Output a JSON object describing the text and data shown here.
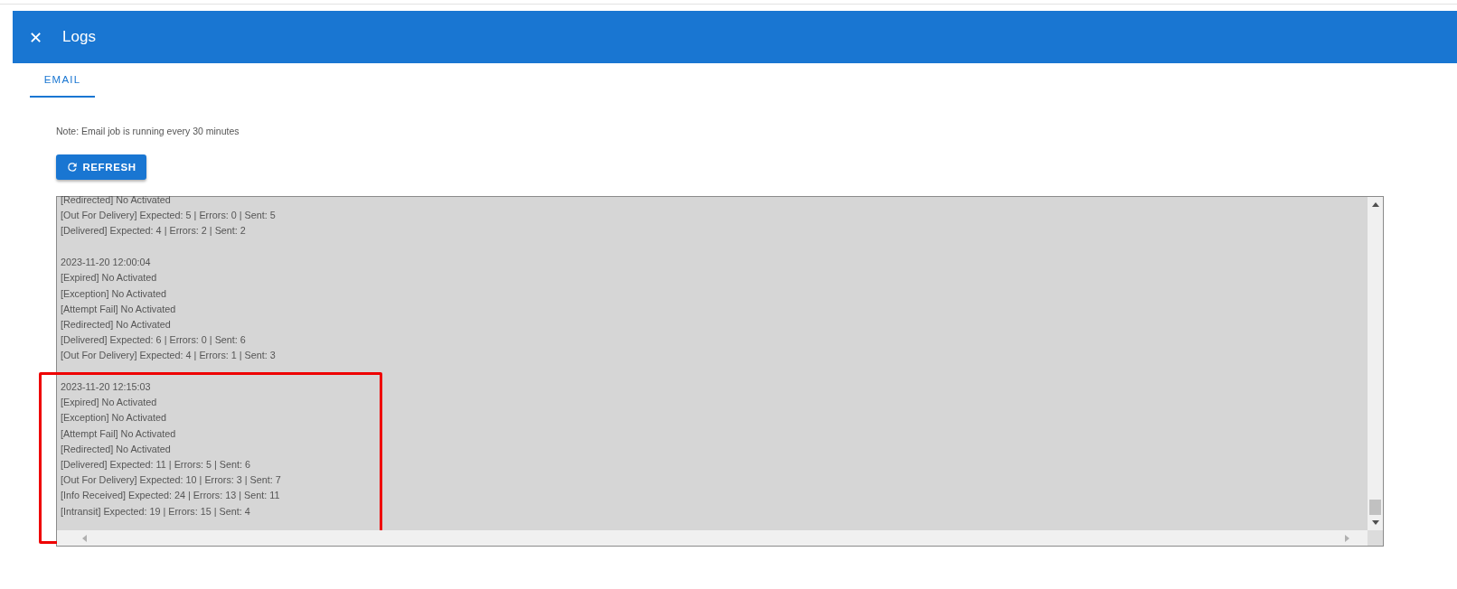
{
  "window": {
    "title": "Logs",
    "close": "✕"
  },
  "tabs": [
    {
      "label": "EMAIL",
      "selected": true
    }
  ],
  "note": "Note: Email job is running every 30 minutes",
  "refresh_button": {
    "label": "REFRESH"
  },
  "log_entries": [
    {
      "highlighted": false,
      "lines": [
        "[Redirected] No Activated",
        "[Out For Delivery] Expected: 5 | Errors: 0 | Sent: 5",
        "[Delivered] Expected: 4 | Errors: 2 | Sent: 2"
      ]
    },
    {
      "highlighted": false,
      "lines": [
        "2023-11-20 12:00:04",
        "[Expired] No Activated",
        "[Exception] No Activated",
        "[Attempt Fail] No Activated",
        "[Redirected] No Activated",
        "[Delivered] Expected: 6 | Errors: 0 | Sent: 6",
        "[Out For Delivery] Expected: 4 | Errors: 1 | Sent: 3"
      ]
    },
    {
      "highlighted": true,
      "lines": [
        "2023-11-20 12:15:03",
        "[Expired] No Activated",
        "[Exception] No Activated",
        "[Attempt Fail] No Activated",
        "[Redirected] No Activated",
        "[Delivered] Expected: 11 | Errors: 5 | Sent: 6",
        "[Out For Delivery] Expected: 10 | Errors: 3 | Sent: 7",
        "[Info Received] Expected: 24 | Errors: 13 | Sent: 11",
        "[Intransit] Expected: 19 | Errors: 15 | Sent: 4"
      ]
    }
  ]
}
